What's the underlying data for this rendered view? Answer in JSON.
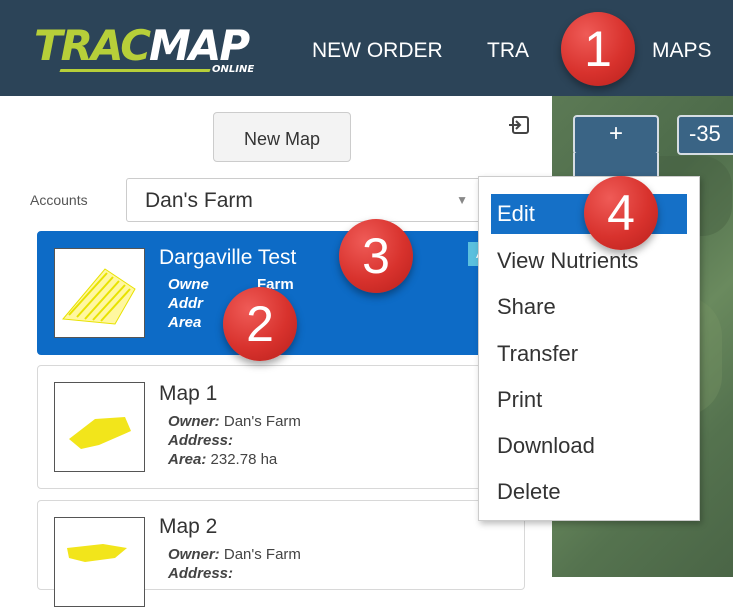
{
  "header": {
    "logo_part1": "TRAC",
    "logo_part2": "MAP",
    "logo_sub": "ONLINE",
    "nav": [
      "NEW ORDER",
      "TRA",
      "MAPS"
    ]
  },
  "sidebar": {
    "new_map_label": "New Map",
    "accounts_label": "Accounts",
    "accounts_value": "Dan's Farm",
    "maps": [
      {
        "title": "Dargaville Test",
        "owner_label": "Owne",
        "owner_value": "Farm",
        "address_label": "Addr",
        "area_label": "Area",
        "badge": "Acti"
      },
      {
        "title": "Map 1",
        "owner_label": "Owner:",
        "owner_value": "Dan's Farm",
        "address_label": "Address:",
        "area_label": "Area:",
        "area_value": "232.78 ha"
      },
      {
        "title": "Map 2",
        "owner_label": "Owner:",
        "owner_value": "Dan's Farm",
        "address_label": "Address:"
      }
    ]
  },
  "map_controls": {
    "zoom_in": "+",
    "coordinate": "-35"
  },
  "context_menu": {
    "items": [
      "Edit",
      "View Nutrients",
      "Share",
      "Transfer",
      "Print",
      "Download",
      "Delete"
    ]
  },
  "callouts": [
    "1",
    "2",
    "3",
    "4"
  ],
  "colors": {
    "header_bg": "#2c4458",
    "logo_green": "#b7cf39",
    "active_card": "#0d6bc6",
    "menu_highlight": "#1570c7",
    "callout_red": "#d8322d"
  }
}
